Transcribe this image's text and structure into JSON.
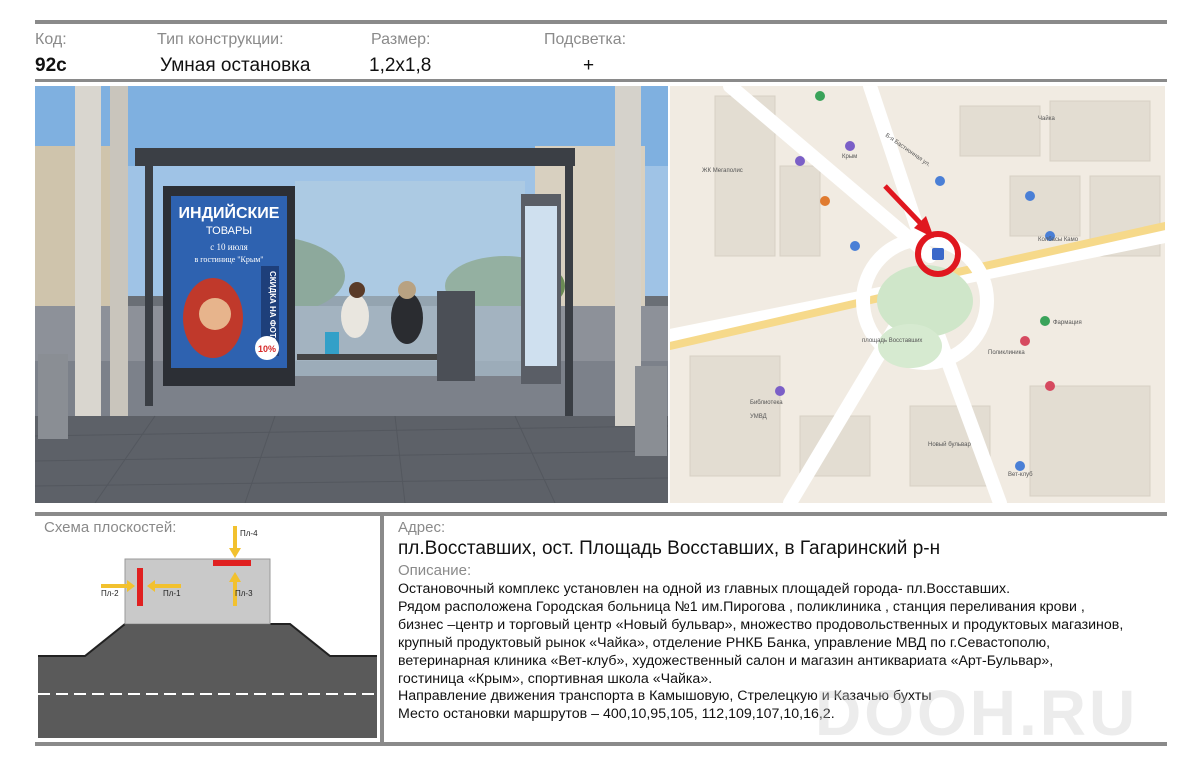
{
  "header": {
    "code_label": "Код:",
    "code_value": "92с",
    "type_label": "Тип конструкции:",
    "type_value": "Умная остановка",
    "size_label": "Размер:",
    "size_value": "1,2x1,8",
    "light_label": "Подсветка:",
    "light_value": "+"
  },
  "photo": {
    "poster_title_1": "ИНДИЙСКИЕ",
    "poster_title_2": "ТОВАРЫ",
    "poster_line_1": "с 10 июля",
    "poster_line_2": "в гостинице \"Крым\"",
    "poster_side": "СКИДКА НА ФОТО",
    "poster_badge": "10%"
  },
  "map": {
    "labels": {
      "street": "Б-я Бастионная ул.",
      "megapolis": "ЖК Мегаполис",
      "square": "площадь Восставших",
      "krym": "Крым",
      "hospital_dept": "Поликлиника",
      "pharmacy": "Фармация",
      "library": "Библиотека",
      "umvd": "УМВД",
      "chaika": "Чайка",
      "vet": "Вет-клуб",
      "bulvar": "Новый бульвар",
      "kolbasy": "Колбасы Камо"
    }
  },
  "scheme": {
    "title": "Схема плоскостей:",
    "planes": [
      "Пл-1",
      "Пл-2",
      "Пл-3",
      "Пл-4"
    ],
    "colors": {
      "road": "#555555",
      "roof": "#c9c9c9",
      "plane": "#e02020",
      "arrow": "#f2c12e"
    }
  },
  "address": {
    "label": "Адрес:",
    "value": "пл.Восставших, ост. Площадь Восставших, в Гагаринский р-н"
  },
  "description": {
    "label": "Описание:",
    "lines": [
      "Остановочный  комплекс установлен на одной из главных площадей города- пл.Восставших.",
      "Рядом расположена  Городская больница №1 им.Пирогова , поликлиника , станция переливания крови ,",
      "бизнес –центр и торговый центр «Новый бульвар», множество продовольственных и продуктовых магазинов,",
      "крупный продуктовый рынок «Чайка», отделение РНКБ Банка, управление МВД по г.Севастополю,",
      "ветеринарная клиника «Вет-клуб»,  художественный салон и магазин антиквариата «Арт-Бульвар»,",
      "гостиница «Крым», спортивная школа «Чайка».",
      "Направление движения транспорта в Камышовую, Стрелецкую и Казачью бухты",
      "Место остановки маршрутов – 400,10,95,105, 112,109,107,10,16,2."
    ]
  },
  "watermark": "DOOH.RU"
}
